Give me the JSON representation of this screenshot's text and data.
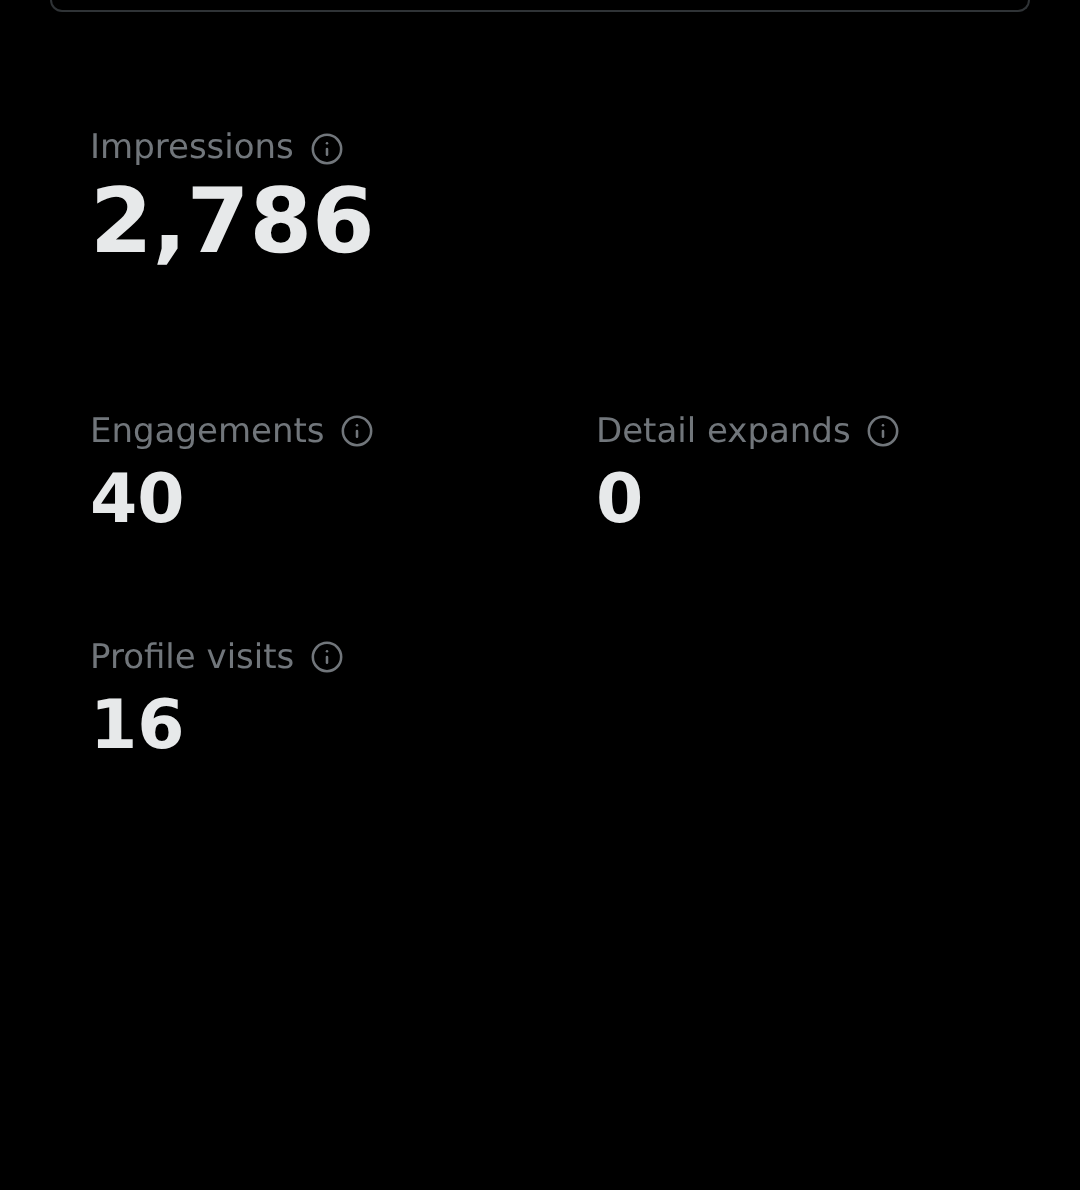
{
  "metrics": [
    {
      "label": "Impressions",
      "value": "2,786",
      "kind": "hero"
    },
    {
      "label": "Engagements",
      "value": "40",
      "kind": "small"
    },
    {
      "label": "Detail expands",
      "value": "0",
      "kind": "small"
    },
    {
      "label": "Profile visits",
      "value": "16",
      "kind": "small"
    }
  ]
}
